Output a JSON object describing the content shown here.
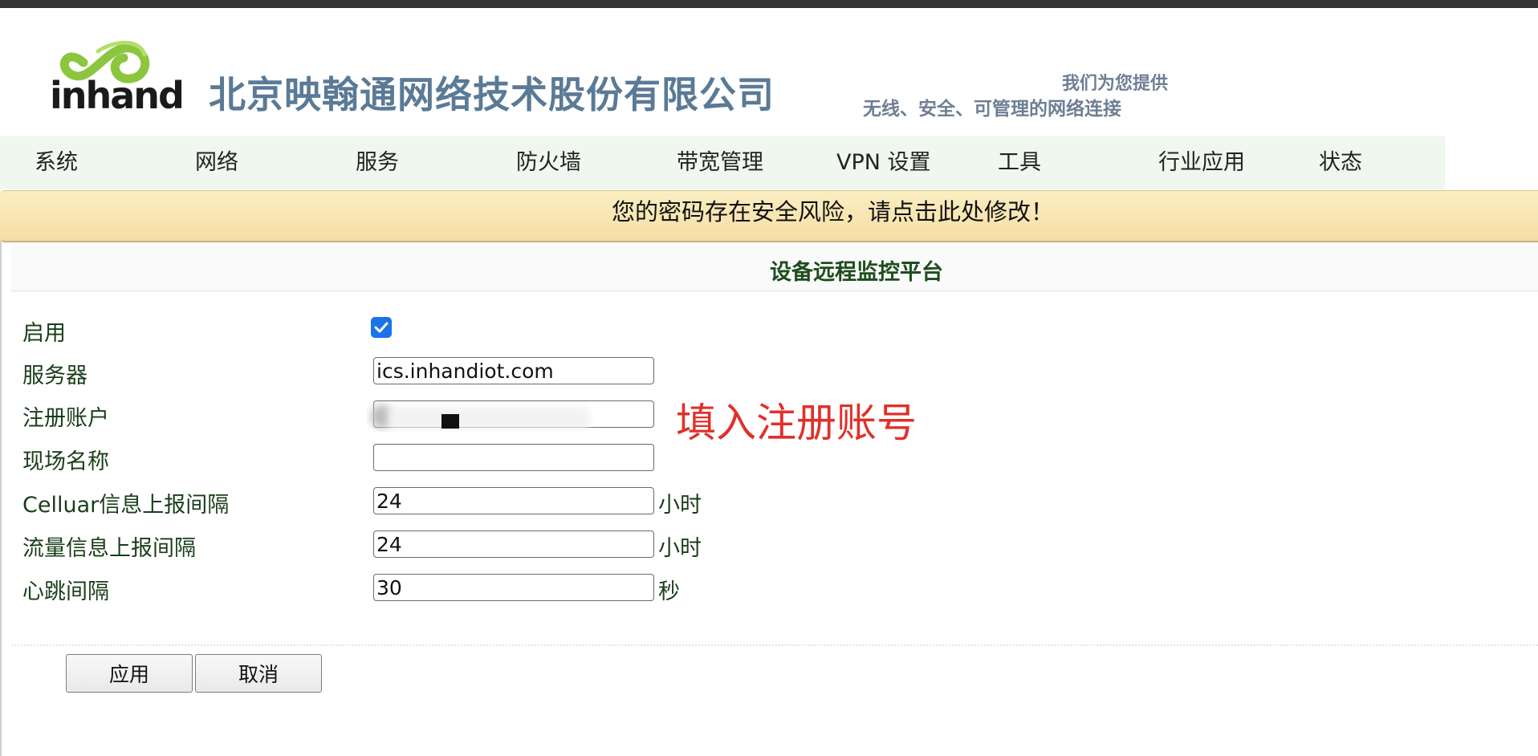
{
  "header": {
    "logo_text": "inhand",
    "company_name": "北京映翰通网络技术股份有限公司",
    "slogan_line1": "我们为您提供",
    "slogan_line2": "无线、安全、可管理的网络连接"
  },
  "nav": {
    "items": [
      "系统",
      "网络",
      "服务",
      "防火墙",
      "带宽管理",
      "VPN 设置",
      "工具",
      "行业应用",
      "状态"
    ]
  },
  "warning": {
    "text": "您的密码存在安全风险，请点击此处修改！"
  },
  "section": {
    "title": "设备远程监控平台"
  },
  "form": {
    "enable": {
      "label": "启用",
      "checked": true
    },
    "server": {
      "label": "服务器",
      "value": "ics.inhandiot.com"
    },
    "account": {
      "label": "注册账户",
      "value": ""
    },
    "site_name": {
      "label": "现场名称",
      "value": ""
    },
    "cellular_interval": {
      "label": "Celluar信息上报间隔",
      "value": "24",
      "unit": "小时"
    },
    "traffic_interval": {
      "label": "流量信息上报间隔",
      "value": "24",
      "unit": "小时"
    },
    "heartbeat_interval": {
      "label": "心跳间隔",
      "value": "30",
      "unit": "秒"
    }
  },
  "annotation": {
    "text": "填入注册账号",
    "color": "#e0302a"
  },
  "buttons": {
    "apply": "应用",
    "cancel": "取消"
  },
  "colors": {
    "nav_bg": "#f0f7ee",
    "warning_bg": "#f8e6b4",
    "label_color": "#1a3d1a",
    "checkbox_accent": "#1a73e8"
  }
}
